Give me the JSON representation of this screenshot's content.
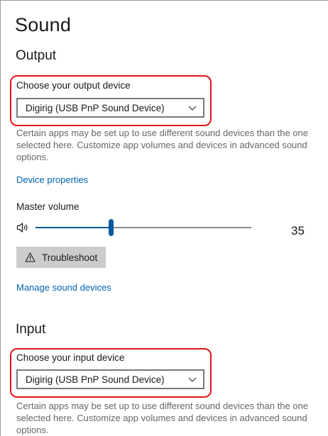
{
  "page": {
    "title": "Sound"
  },
  "output": {
    "heading": "Output",
    "device_label": "Choose your output device",
    "device_selected": "Digirig (USB PnP Sound Device)",
    "description": "Certain apps may be set up to use different sound devices than the one selected here. Customize app volumes and devices in advanced sound options.",
    "device_properties_link": "Device properties",
    "master_volume_label": "Master volume",
    "master_volume_value": "35",
    "master_volume_level": 35,
    "troubleshoot_label": "Troubleshoot",
    "manage_devices_link": "Manage sound devices"
  },
  "input": {
    "heading": "Input",
    "device_label": "Choose your input device",
    "device_selected": "Digirig (USB PnP Sound Device)",
    "description": "Certain apps may be set up to use different sound devices than the one selected here. Customize app volumes and devices in advanced sound options."
  },
  "colors": {
    "highlight": "#e3151b",
    "accent": "#005a9e",
    "link": "#0063b1"
  },
  "icons": [
    "speaker-icon",
    "warning-icon",
    "chevron-down-icon"
  ]
}
